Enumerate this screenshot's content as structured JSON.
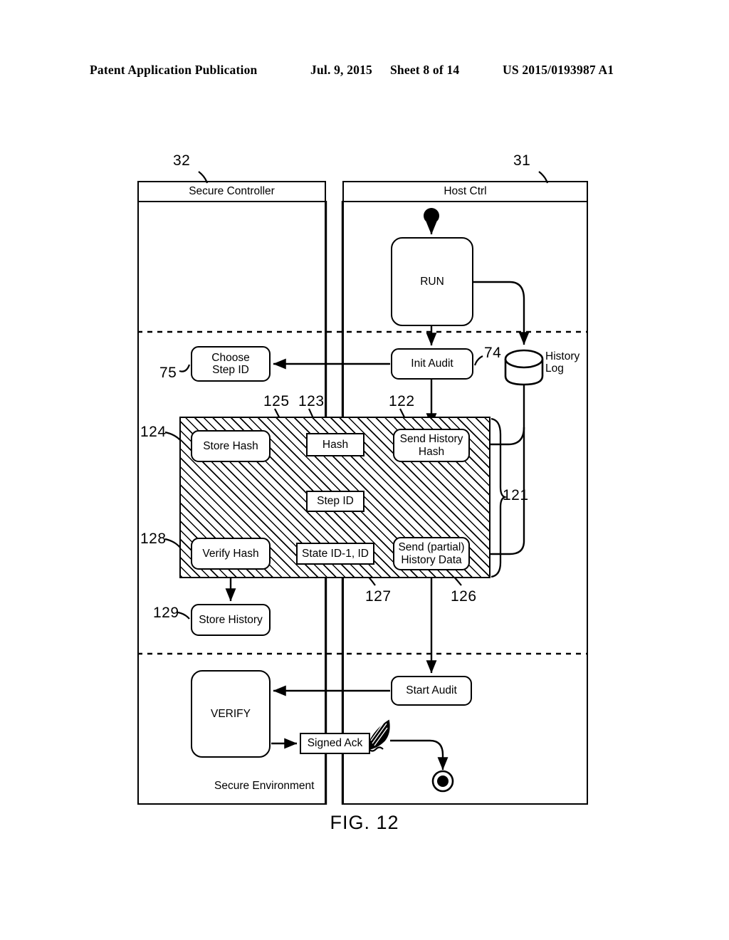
{
  "header": {
    "publication": "Patent Application Publication",
    "date": "Jul. 9, 2015",
    "sheet": "Sheet 8 of 14",
    "number": "US 2015/0193987 A1"
  },
  "figure": {
    "caption": "FIG. 12"
  },
  "lanes": [
    {
      "id": "secure-controller",
      "title": "Secure Controller",
      "ref": "32",
      "footnote": "Secure Environment"
    },
    {
      "id": "host-ctrl",
      "title": "Host Ctrl",
      "ref": "31",
      "footnote": ""
    }
  ],
  "nodes": {
    "run": "RUN",
    "init_audit": "Init Audit",
    "choose_step_id": "Choose\nStep ID",
    "store_hash": "Store Hash",
    "hash": "Hash",
    "send_history_hash": "Send History\nHash",
    "step_id": "Step ID",
    "verify_hash": "Verify Hash",
    "state_id": "State ID-1, ID",
    "send_partial_history_data": "Send (partial)\nHistory Data",
    "store_history": "Store History",
    "start_audit": "Start Audit",
    "verify": "VERIFY",
    "signed_ack": "Signed Ack",
    "history_log": "History\nLog"
  },
  "refs": {
    "r31": "31",
    "r32": "32",
    "r74": "74",
    "r75": "75",
    "r121": "121",
    "r122": "122",
    "r123": "123",
    "r124": "124",
    "r125": "125",
    "r126": "126",
    "r127": "127",
    "r128": "128",
    "r129": "129"
  },
  "icons": {
    "start_node": "filled-circle-start-icon",
    "end_node": "bullseye-end-icon",
    "history_log": "database-cylinder-icon",
    "signature": "quill-feather-icon"
  },
  "colors": {
    "stroke": "#000000",
    "background": "#ffffff"
  }
}
